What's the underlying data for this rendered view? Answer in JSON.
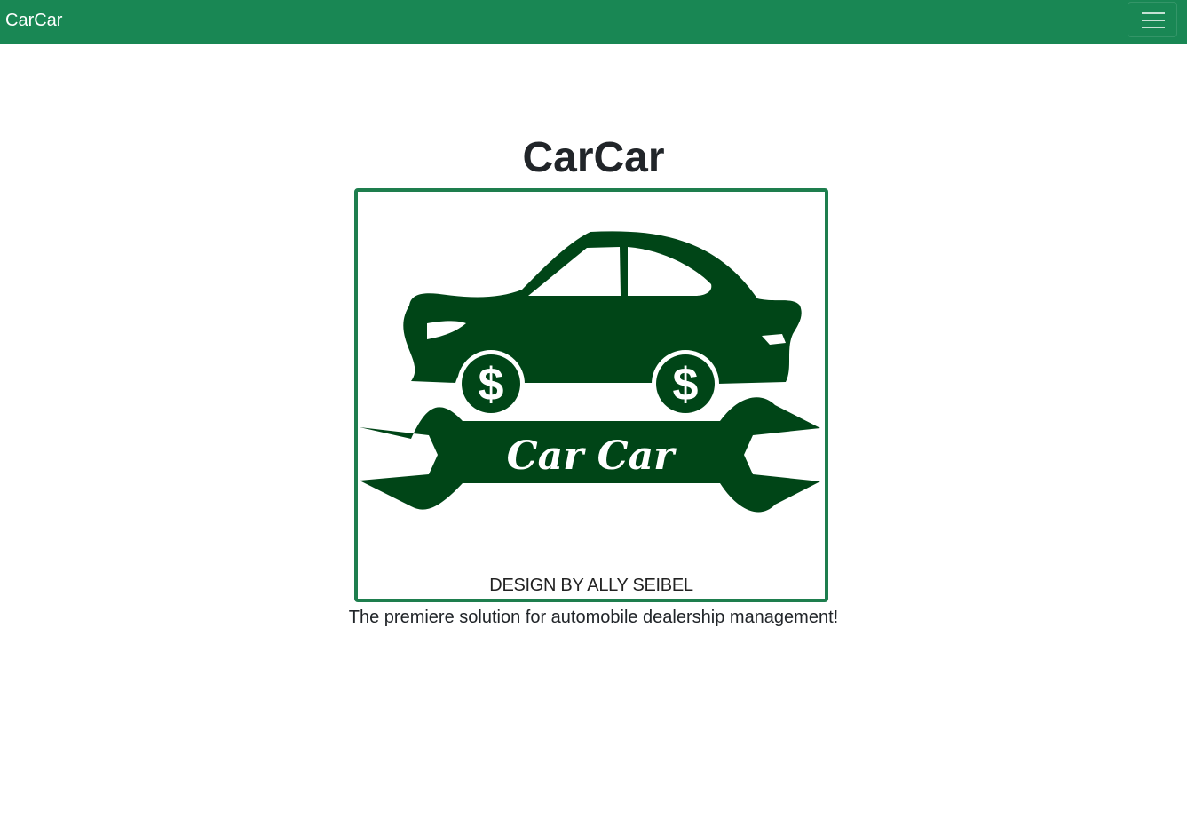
{
  "navbar": {
    "brand": "CarCar",
    "toggler_icon": "hamburger-menu-icon",
    "background": "#198754"
  },
  "main": {
    "title": "CarCar",
    "logo": {
      "wordmark": "Car Car",
      "credit": "DESIGN BY ALLY SEIBEL",
      "accent": "#004517",
      "border_color": "#1e7e4e",
      "wheel_symbol": "$"
    },
    "tagline": "The premiere solution for automobile dealership management!"
  }
}
